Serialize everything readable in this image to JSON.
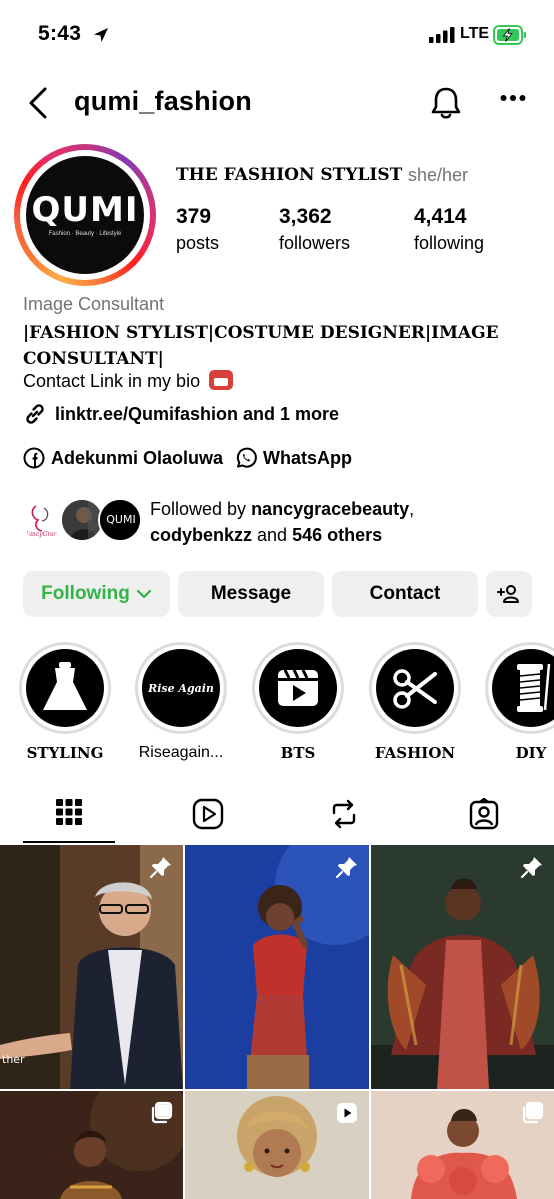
{
  "status_bar": {
    "time": "5:43",
    "network": "LTE"
  },
  "header": {
    "username": "qumi_fashion"
  },
  "profile": {
    "avatar_logo": "QUMI",
    "avatar_tagline": "Fashion · Beauty · Lifestyle",
    "name": "THE FASHION STYLIST",
    "pronouns": "she/her",
    "stats": [
      {
        "value": "379",
        "label": "posts"
      },
      {
        "value": "3,362",
        "label": "followers"
      },
      {
        "value": "4,414",
        "label": "following"
      }
    ],
    "category": "Image Consultant",
    "bio_line1": "|FASHION STYLIST|COSTUME DESIGNER|IMAGE CONSULTANT|",
    "bio_line2": "Contact Link in my bio",
    "link": "linktr.ee/Qumifashion and 1 more",
    "social": [
      {
        "icon": "facebook-icon",
        "label": "Adekunmi Olaoluwa"
      },
      {
        "icon": "whatsapp-icon",
        "label": "WhatsApp"
      }
    ],
    "followed_by": {
      "prefix": "Followed by ",
      "user1": "nancygracebeauty",
      "sep": ",",
      "user2": "codybenkzz",
      "and": " and ",
      "others": "546 others",
      "mini_avatar_texts": [
        "NancyGrace",
        "",
        "QUMI"
      ]
    }
  },
  "actions": {
    "following": "Following",
    "message": "Message",
    "contact": "Contact"
  },
  "highlights": [
    {
      "label": "STYLING",
      "icon": "dress-icon"
    },
    {
      "label": "Riseagain...",
      "icon": "rise-again-logo",
      "text": "Rise Again"
    },
    {
      "label": "BTS",
      "icon": "clapperboard-icon"
    },
    {
      "label": "FASHION",
      "icon": "scissors-icon"
    },
    {
      "label": "DIY",
      "icon": "thread-spool-icon"
    }
  ],
  "tabs": [
    "grid-icon",
    "reels-icon",
    "reposts-icon",
    "tagged-icon"
  ],
  "posts": [
    {
      "badge": "pin-icon",
      "caption_fragment": "ther"
    },
    {
      "badge": "pin-icon"
    },
    {
      "badge": "pin-icon"
    },
    {
      "badge": "carousel-icon"
    },
    {
      "badge": "reel-icon"
    },
    {
      "badge": "carousel-icon"
    }
  ],
  "colors": {
    "following_green": "#33b447",
    "button_bg": "#efefef",
    "secondary_text": "#737373",
    "battery_green": "#34c759"
  }
}
